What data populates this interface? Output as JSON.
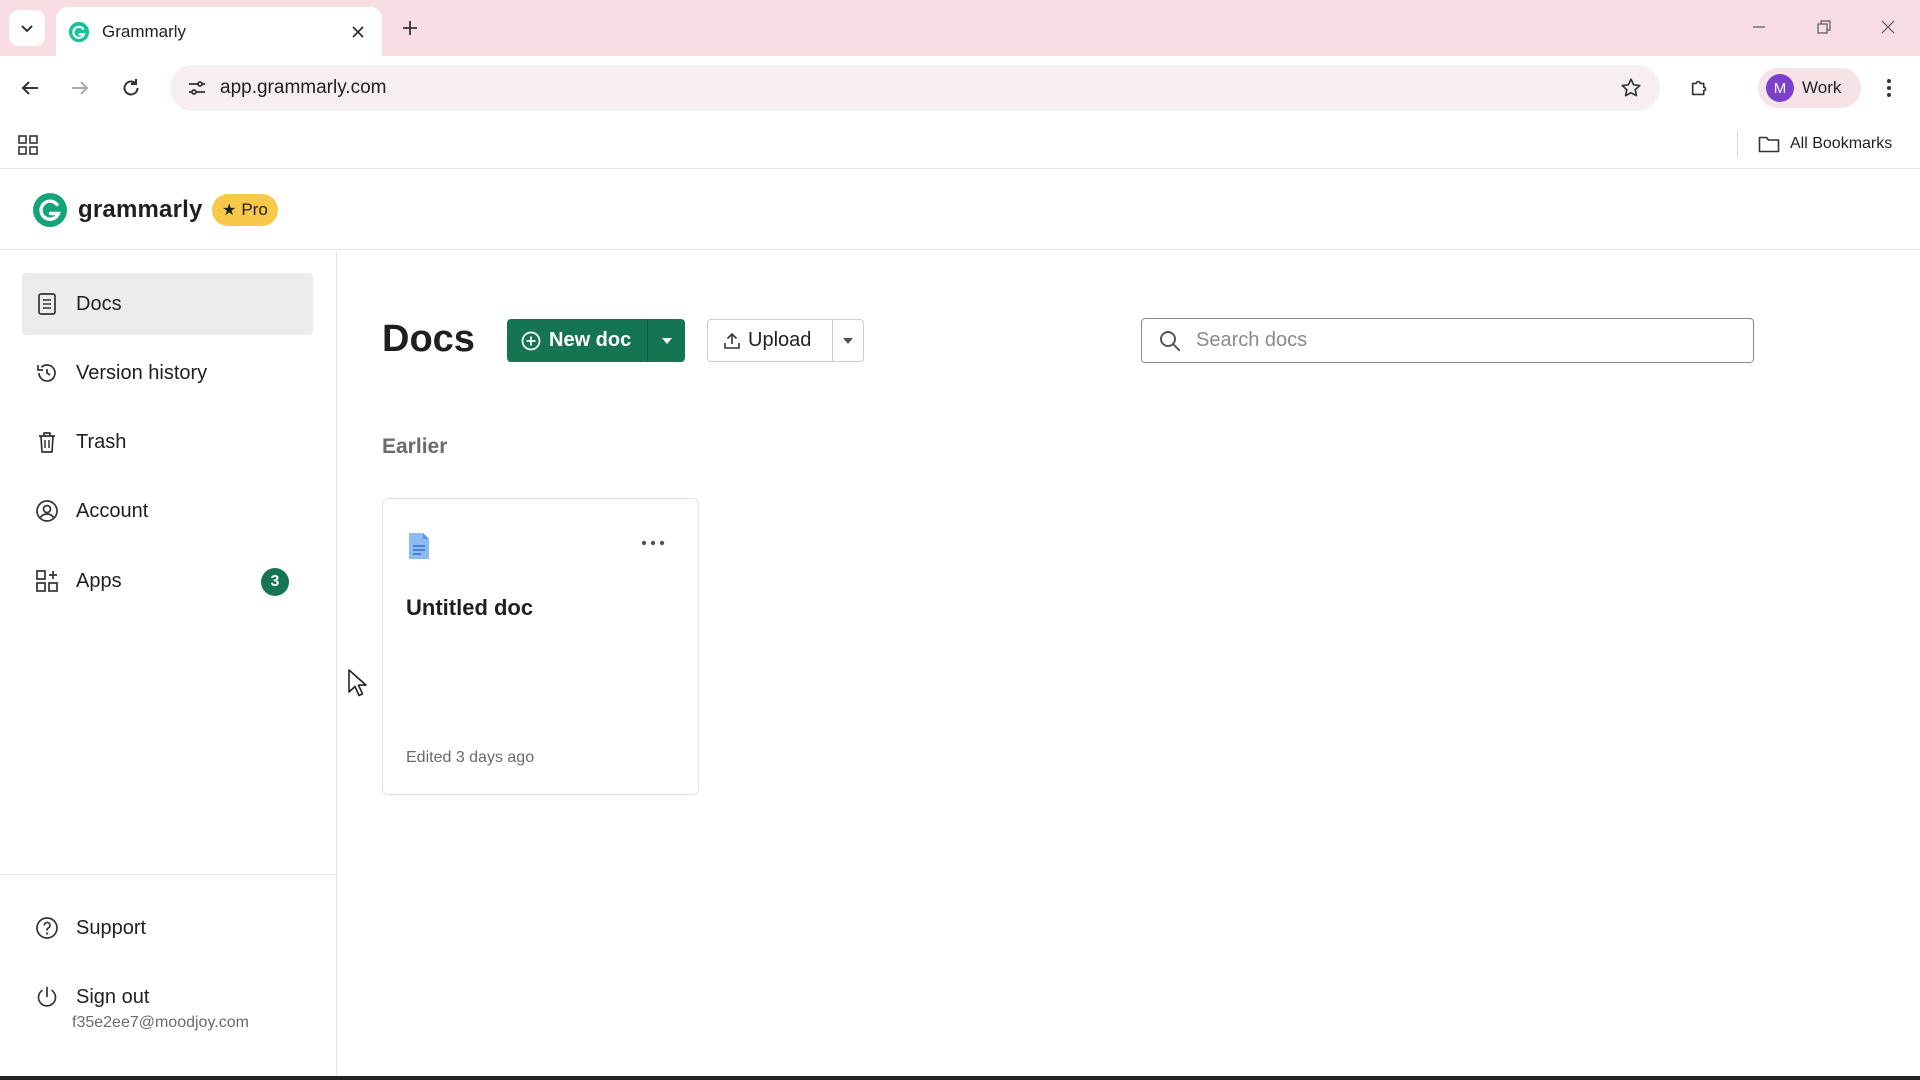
{
  "browser": {
    "tab_title": "Grammarly",
    "url": "app.grammarly.com",
    "profile_initial": "M",
    "profile_label": "Work",
    "all_bookmarks_label": "All Bookmarks"
  },
  "app": {
    "brand_name": "grammarly",
    "plan_badge": "Pro",
    "accent_color": "#157552",
    "badge_color": "#f7c84a"
  },
  "sidebar": {
    "items": [
      {
        "label": "Docs",
        "icon": "document-icon",
        "active": true
      },
      {
        "label": "Version history",
        "icon": "history-icon"
      },
      {
        "label": "Trash",
        "icon": "trash-icon"
      },
      {
        "label": "Account",
        "icon": "account-icon"
      },
      {
        "label": "Apps",
        "icon": "apps-icon",
        "badge": "3"
      }
    ],
    "footer": [
      {
        "label": "Support",
        "icon": "help-icon"
      },
      {
        "label": "Sign out",
        "icon": "power-icon"
      }
    ],
    "user_email": "f35e2ee7@moodjoy.com"
  },
  "main": {
    "title": "Docs",
    "new_doc_label": "New doc",
    "upload_label": "Upload",
    "search_placeholder": "Search docs",
    "section_label": "Earlier",
    "docs": [
      {
        "title": "Untitled doc",
        "meta": "Edited 3 days ago"
      }
    ]
  }
}
